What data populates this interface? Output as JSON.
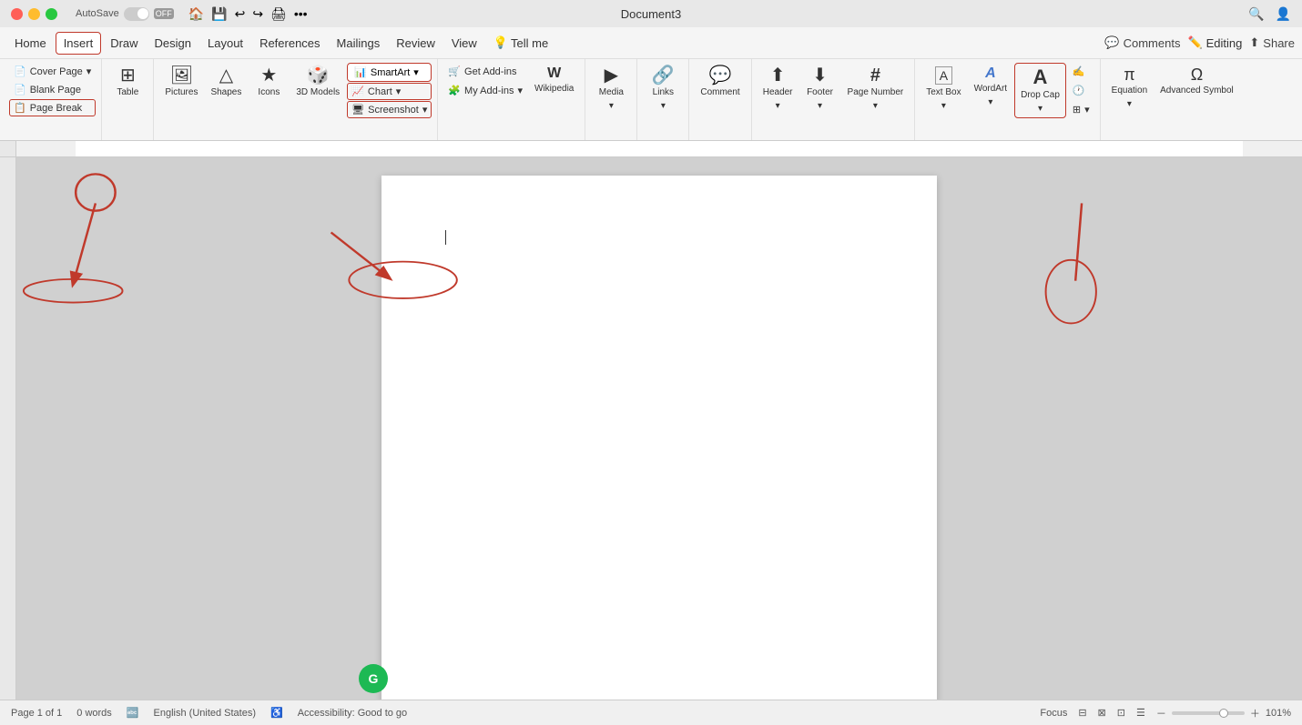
{
  "titlebar": {
    "autosave_label": "AutoSave",
    "toggle_state": "OFF",
    "doc_title": "Document3",
    "icons": [
      "search",
      "profile"
    ]
  },
  "menubar": {
    "items": [
      "Home",
      "Insert",
      "Draw",
      "Design",
      "Layout",
      "References",
      "Mailings",
      "Review",
      "View",
      "Tell me"
    ],
    "active_item": "Insert",
    "right": {
      "comments_label": "Comments",
      "editing_label": "Editing",
      "share_label": "Share"
    }
  },
  "ribbon": {
    "groups": [
      {
        "name": "pages",
        "label": "",
        "items": [
          {
            "id": "cover-page",
            "label": "Cover Page",
            "icon": "📄",
            "has_arrow": true
          },
          {
            "id": "blank-page",
            "label": "Blank Page",
            "icon": "📄"
          },
          {
            "id": "page-break",
            "label": "Page Break",
            "icon": "📋"
          }
        ]
      },
      {
        "name": "table",
        "label": "Table",
        "items": [
          {
            "id": "table",
            "label": "Table",
            "icon": "⊞",
            "has_arrow": true
          }
        ]
      },
      {
        "name": "illustrations",
        "label": "",
        "items": [
          {
            "id": "pictures",
            "label": "Pictures",
            "icon": "🖼",
            "has_arrow": true
          },
          {
            "id": "shapes",
            "label": "Shapes",
            "icon": "△",
            "has_arrow": true
          },
          {
            "id": "icons",
            "label": "Icons",
            "icon": "★"
          },
          {
            "id": "3d-models",
            "label": "3D Models",
            "icon": "🎲"
          },
          {
            "id": "smartart",
            "label": "SmartArt",
            "icon": "📊",
            "highlighted": true,
            "has_arrow": true
          },
          {
            "id": "chart",
            "label": "Chart",
            "icon": "📈",
            "has_arrow": true
          },
          {
            "id": "screenshot",
            "label": "Screenshot",
            "icon": "🖥",
            "has_arrow": true
          }
        ]
      },
      {
        "name": "addins",
        "label": "",
        "items": [
          {
            "id": "get-addins",
            "label": "Get Add-ins",
            "icon": "🛒"
          },
          {
            "id": "wikipedia",
            "label": "Wikipedia",
            "icon": "W"
          },
          {
            "id": "my-addins",
            "label": "My Add-ins",
            "icon": "🧩",
            "has_arrow": true
          }
        ]
      },
      {
        "name": "media",
        "label": "",
        "items": [
          {
            "id": "media",
            "label": "Media",
            "icon": "▶",
            "has_arrow": true
          }
        ]
      },
      {
        "name": "links",
        "label": "",
        "items": [
          {
            "id": "links",
            "label": "Links",
            "icon": "🔗",
            "has_arrow": true
          }
        ]
      },
      {
        "name": "comments",
        "label": "",
        "items": [
          {
            "id": "comment",
            "label": "Comment",
            "icon": "💬"
          }
        ]
      },
      {
        "name": "header-footer",
        "label": "",
        "items": [
          {
            "id": "header",
            "label": "Header",
            "icon": "⬆",
            "has_arrow": true
          },
          {
            "id": "footer",
            "label": "Footer",
            "icon": "⬇",
            "has_arrow": true
          },
          {
            "id": "page-number",
            "label": "Page Number",
            "icon": "#",
            "has_arrow": true
          }
        ]
      },
      {
        "name": "text",
        "label": "",
        "items": [
          {
            "id": "text-box",
            "label": "Text Box",
            "icon": "A",
            "has_arrow": true
          },
          {
            "id": "wordart",
            "label": "WordArt",
            "icon": "A",
            "has_arrow": true
          },
          {
            "id": "drop-cap",
            "label": "Drop Cap",
            "icon": "A",
            "has_arrow": true
          },
          {
            "id": "text-extras",
            "label": "",
            "icon": "⊞"
          }
        ]
      },
      {
        "name": "symbols",
        "label": "",
        "items": [
          {
            "id": "equation",
            "label": "Equation",
            "icon": "π",
            "has_arrow": true
          },
          {
            "id": "advanced-symbol",
            "label": "Advanced Symbol",
            "icon": "Ω"
          }
        ]
      }
    ]
  },
  "document": {
    "page_info": "Page 1 of 1",
    "word_count": "0 words",
    "language": "English (United States)",
    "accessibility": "Accessibility: Good to go",
    "focus_label": "Focus",
    "zoom_level": "101%"
  },
  "annotations": {
    "circles": [
      {
        "id": "insert-circle",
        "label": "Insert tab circle"
      },
      {
        "id": "page-break-circle",
        "label": "Page Break circle"
      },
      {
        "id": "chart-screenshot-circle",
        "label": "Chart/Screenshot circle"
      },
      {
        "id": "drop-cap-circle",
        "label": "Drop Cap circle"
      }
    ]
  }
}
